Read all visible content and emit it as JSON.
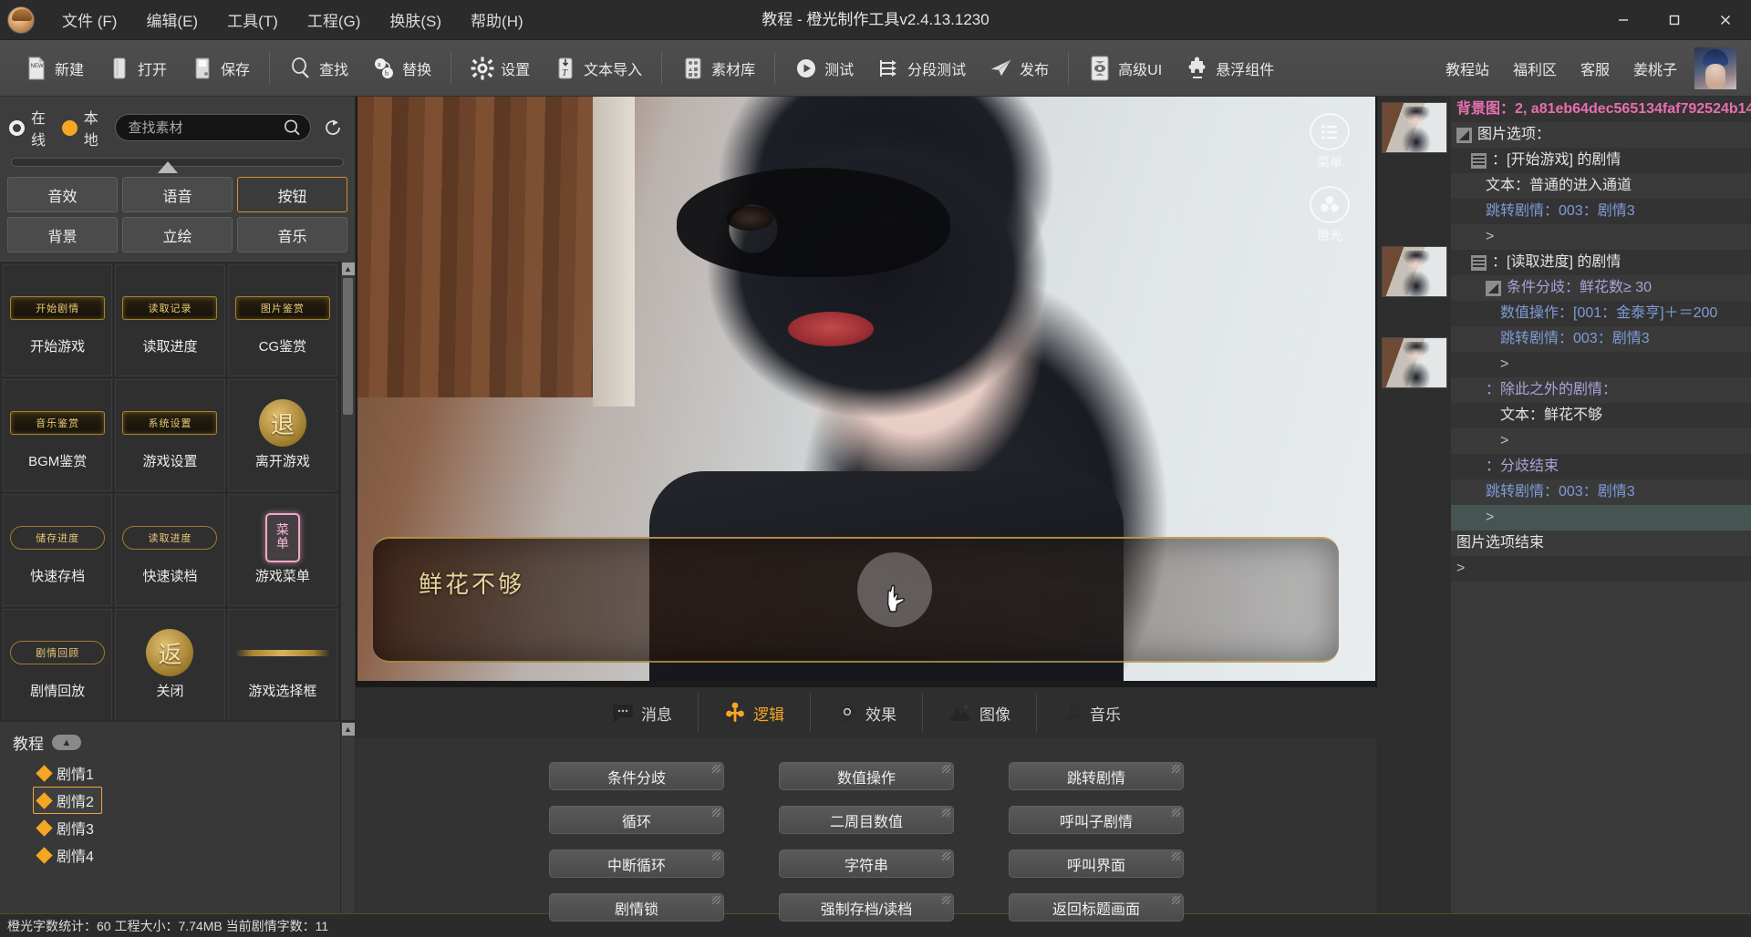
{
  "window": {
    "title": "教程 - 橙光制作工具v2.4.13.1230",
    "minimize": "最小化",
    "maximize": "最大化",
    "close": "关闭"
  },
  "menubar": [
    {
      "label": "文件 (F)",
      "name": "menu-file"
    },
    {
      "label": "编辑(E)",
      "name": "menu-edit"
    },
    {
      "label": "工具(T)",
      "name": "menu-tools"
    },
    {
      "label": "工程(G)",
      "name": "menu-project"
    },
    {
      "label": "换肤(S)",
      "name": "menu-skin"
    },
    {
      "label": "帮助(H)",
      "name": "menu-help"
    }
  ],
  "toolbar": {
    "groups": [
      [
        {
          "label": "新建",
          "icon": "new-file-icon"
        },
        {
          "label": "打开",
          "icon": "open-folder-icon"
        },
        {
          "label": "保存",
          "icon": "save-disk-icon"
        }
      ],
      [
        {
          "label": "查找",
          "icon": "search-icon"
        },
        {
          "label": "替换",
          "icon": "replace-icon"
        }
      ],
      [
        {
          "label": "设置",
          "icon": "gear-icon"
        },
        {
          "label": "文本导入",
          "icon": "text-import-icon"
        }
      ],
      [
        {
          "label": "素材库",
          "icon": "asset-library-icon"
        }
      ],
      [
        {
          "label": "测试",
          "icon": "play-icon"
        },
        {
          "label": "分段测试",
          "icon": "segment-test-icon"
        },
        {
          "label": "发布",
          "icon": "publish-plane-icon"
        }
      ],
      [
        {
          "label": "高级UI",
          "icon": "advanced-ui-icon"
        },
        {
          "label": "悬浮组件",
          "icon": "floating-widget-icon"
        }
      ]
    ],
    "links": [
      {
        "label": "教程站",
        "name": "link-tutorial-site"
      },
      {
        "label": "福利区",
        "name": "link-benefits"
      },
      {
        "label": "客服",
        "name": "link-support"
      },
      {
        "label": "姜桃子",
        "name": "link-username"
      }
    ]
  },
  "assets": {
    "source_options": [
      {
        "label": "在线",
        "selected": false
      },
      {
        "label": "本地",
        "selected": true
      }
    ],
    "search_placeholder": "查找素材",
    "search_value": "",
    "search_icon": "search-icon",
    "refresh_icon": "refresh-icon",
    "categories": [
      {
        "label": "音效",
        "active": false
      },
      {
        "label": "语音",
        "active": false
      },
      {
        "label": "按钮",
        "active": true
      },
      {
        "label": "背景",
        "active": false
      },
      {
        "label": "立绘",
        "active": false
      },
      {
        "label": "音乐",
        "active": false
      }
    ],
    "items": [
      {
        "name": "开始游戏",
        "thumb_kind": "plaque",
        "thumb_text": "开始剧情"
      },
      {
        "name": "读取进度",
        "thumb_kind": "plaque",
        "thumb_text": "读取记录"
      },
      {
        "name": "CG鉴赏",
        "thumb_kind": "plaque",
        "thumb_text": "图片鉴赏"
      },
      {
        "name": "BGM鉴赏",
        "thumb_kind": "plaque",
        "thumb_text": "音乐鉴赏"
      },
      {
        "name": "游戏设置",
        "thumb_kind": "plaque",
        "thumb_text": "系统设置"
      },
      {
        "name": "离开游戏",
        "thumb_kind": "coin",
        "thumb_text": "退"
      },
      {
        "name": "快速存档",
        "thumb_kind": "thin",
        "thumb_text": "储存进度"
      },
      {
        "name": "快速读档",
        "thumb_kind": "thin",
        "thumb_text": "读取进度"
      },
      {
        "name": "游戏菜单",
        "thumb_kind": "pink",
        "thumb_text": "菜单"
      },
      {
        "name": "剧情回放",
        "thumb_kind": "thin",
        "thumb_text": "剧情回顾"
      },
      {
        "name": "关闭",
        "thumb_kind": "coin",
        "thumb_text": "返"
      },
      {
        "name": "游戏选择框",
        "thumb_kind": "bar",
        "thumb_text": ""
      }
    ]
  },
  "tree": {
    "root": "教程",
    "collapse_icon": "chevron-up-icon",
    "items": [
      {
        "label": "剧情1",
        "selected": false
      },
      {
        "label": "剧情2",
        "selected": true
      },
      {
        "label": "剧情3",
        "selected": false
      },
      {
        "label": "剧情4",
        "selected": false
      }
    ]
  },
  "preview": {
    "dialog_text": "鲜花不够",
    "stage_buttons": [
      {
        "label": "菜单",
        "icon": "list-menu-icon"
      },
      {
        "label": "橙光",
        "icon": "orange-light-icon"
      }
    ]
  },
  "editor_tabs": [
    {
      "label": "消息",
      "icon": "message-icon",
      "active": false
    },
    {
      "label": "逻辑",
      "icon": "logic-icon",
      "active": true
    },
    {
      "label": "效果",
      "icon": "effect-icon",
      "active": false
    },
    {
      "label": "图像",
      "icon": "image-icon",
      "active": false
    },
    {
      "label": "音乐",
      "icon": "music-icon",
      "active": false
    }
  ],
  "logic_buttons": [
    "条件分歧",
    "数值操作",
    "跳转剧情",
    "循环",
    "二周目数值",
    "呼叫子剧情",
    "中断循环",
    "字符串",
    "呼叫界面",
    "剧情锁",
    "强制存档/读档",
    "返回标题画面"
  ],
  "script": [
    {
      "indent": 0,
      "icon": "none",
      "text": "背景图：2, a81eb64dec565134faf792524b14",
      "color": "pink",
      "rowstyle": "alt"
    },
    {
      "indent": 0,
      "icon": "triangle",
      "text": "图片选项：",
      "color": "white",
      "rowstyle": "plain"
    },
    {
      "indent": 1,
      "icon": "list",
      "text": "：[开始游戏] 的剧情",
      "color": "white",
      "rowstyle": "alt"
    },
    {
      "indent": 2,
      "icon": "none",
      "text": "文本：普通的进入通道",
      "color": "white",
      "rowstyle": "plain"
    },
    {
      "indent": 2,
      "icon": "none",
      "text": "跳转剧情：003：剧情3",
      "color": "blue",
      "rowstyle": "alt"
    },
    {
      "indent": 2,
      "icon": "none",
      "text": ">",
      "color": "gray",
      "rowstyle": "plain"
    },
    {
      "indent": 1,
      "icon": "list",
      "text": "：[读取进度] 的剧情",
      "color": "white",
      "rowstyle": "alt"
    },
    {
      "indent": 2,
      "icon": "triangle",
      "text": "条件分歧：鲜花数≥ 30",
      "color": "lav",
      "rowstyle": "plain"
    },
    {
      "indent": 3,
      "icon": "none",
      "text": "数值操作：[001：金泰亨]＋＝200",
      "color": "blue",
      "rowstyle": "alt"
    },
    {
      "indent": 3,
      "icon": "none",
      "text": "跳转剧情：003：剧情3",
      "color": "blue",
      "rowstyle": "plain"
    },
    {
      "indent": 3,
      "icon": "none",
      "text": ">",
      "color": "gray",
      "rowstyle": "alt"
    },
    {
      "indent": 2,
      "icon": "none",
      "text": "：除此之外的剧情：",
      "color": "lav",
      "rowstyle": "plain"
    },
    {
      "indent": 3,
      "icon": "none",
      "text": "文本：鲜花不够",
      "color": "white",
      "rowstyle": "alt"
    },
    {
      "indent": 3,
      "icon": "none",
      "text": ">",
      "color": "gray",
      "rowstyle": "plain"
    },
    {
      "indent": 2,
      "icon": "none",
      "text": "：分歧结束",
      "color": "lav",
      "rowstyle": "alt"
    },
    {
      "indent": 2,
      "icon": "none",
      "text": "跳转剧情：003：剧情3",
      "color": "blue",
      "rowstyle": "plain"
    },
    {
      "indent": 2,
      "icon": "none",
      "text": ">",
      "color": "gray",
      "rowstyle": "sel"
    },
    {
      "indent": 0,
      "icon": "none",
      "text": "图片选项结束",
      "color": "white",
      "rowstyle": "plain"
    },
    {
      "indent": 0,
      "icon": "none",
      "text": ">",
      "color": "gray",
      "rowstyle": "alt"
    }
  ],
  "statusbar": {
    "text": "橙光字数统计：60 工程大小：7.74MB 当前剧情字数：11"
  },
  "colors": {
    "accent": "#f5a623",
    "pink": "#e86fb0",
    "blue": "#7f9bd8",
    "lavender": "#a9a3d8",
    "gold": "#e9d49a"
  }
}
